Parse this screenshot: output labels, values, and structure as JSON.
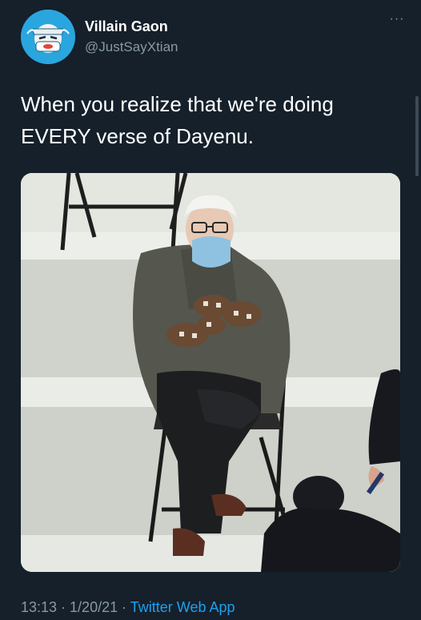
{
  "author": {
    "display_name": "Villain Gaon",
    "handle": "@JustSayXtian",
    "avatar_icon": "masked-face-avatar"
  },
  "more_label": "···",
  "tweet": {
    "text_line1": "When you realize that we're doing",
    "text_line2": "EVERY verse of Dayenu."
  },
  "media": {
    "icon": "photo-of-seated-man-in-mittens"
  },
  "footer": {
    "time": "13:13",
    "separator1": " · ",
    "date": "1/20/21",
    "separator2": " · ",
    "source": "Twitter Web App"
  },
  "colors": {
    "background": "#15202b",
    "text": "#ffffff",
    "muted": "#8899a6",
    "accent": "#1da1f2",
    "avatar_bg": "#2aa6de"
  }
}
